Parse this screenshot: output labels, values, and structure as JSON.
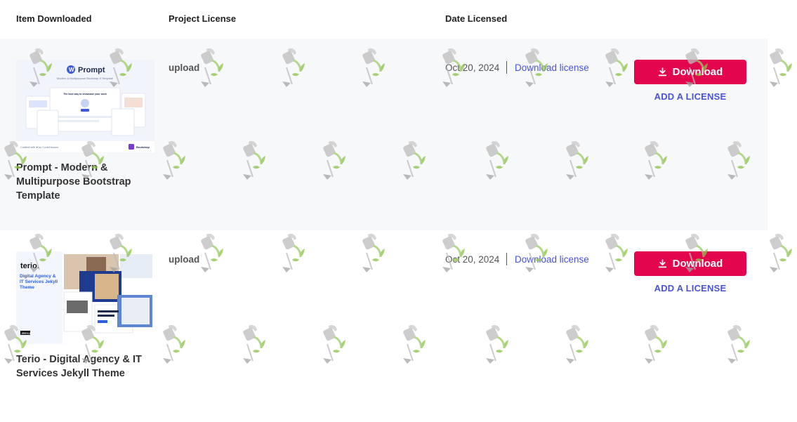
{
  "columns": {
    "item": "Item Downloaded",
    "license": "Project License",
    "date": "Date Licensed"
  },
  "items": [
    {
      "title": "Prompt - Modern & Multipurpose Bootstrap Template",
      "thumb_brand": "Prompt",
      "thumb_subtitle": "Modern & Multipurpose Bootstrap 5 Template",
      "thumb_headline": "The best way to showcase your work",
      "thumb_footer": "Crafted with ♥ by CodeHouses",
      "thumb_badge": "Bootstrap",
      "license": "upload",
      "date": "Oct 20, 2024",
      "download_license": "Download license",
      "download_button": "Download",
      "add_license": "ADD A LICENSE"
    },
    {
      "title": "Terio - Digital Agency & IT Services Jekyll Theme",
      "thumb_brand": "terio.",
      "thumb_tagline": "Digital Agency & IT Services Jekyll Theme",
      "thumb_badge": "JEKYLL",
      "license": "upload",
      "date": "Oct 20, 2024",
      "download_license": "Download license",
      "download_button": "Download",
      "add_license": "ADD A LICENSE"
    }
  ],
  "colors": {
    "accent": "#e3064f",
    "link": "#4a52d6",
    "row_shade": "#f7f8fa"
  },
  "icons": {
    "download": "download-icon",
    "watermark": "watering-can-plant-watermark"
  }
}
